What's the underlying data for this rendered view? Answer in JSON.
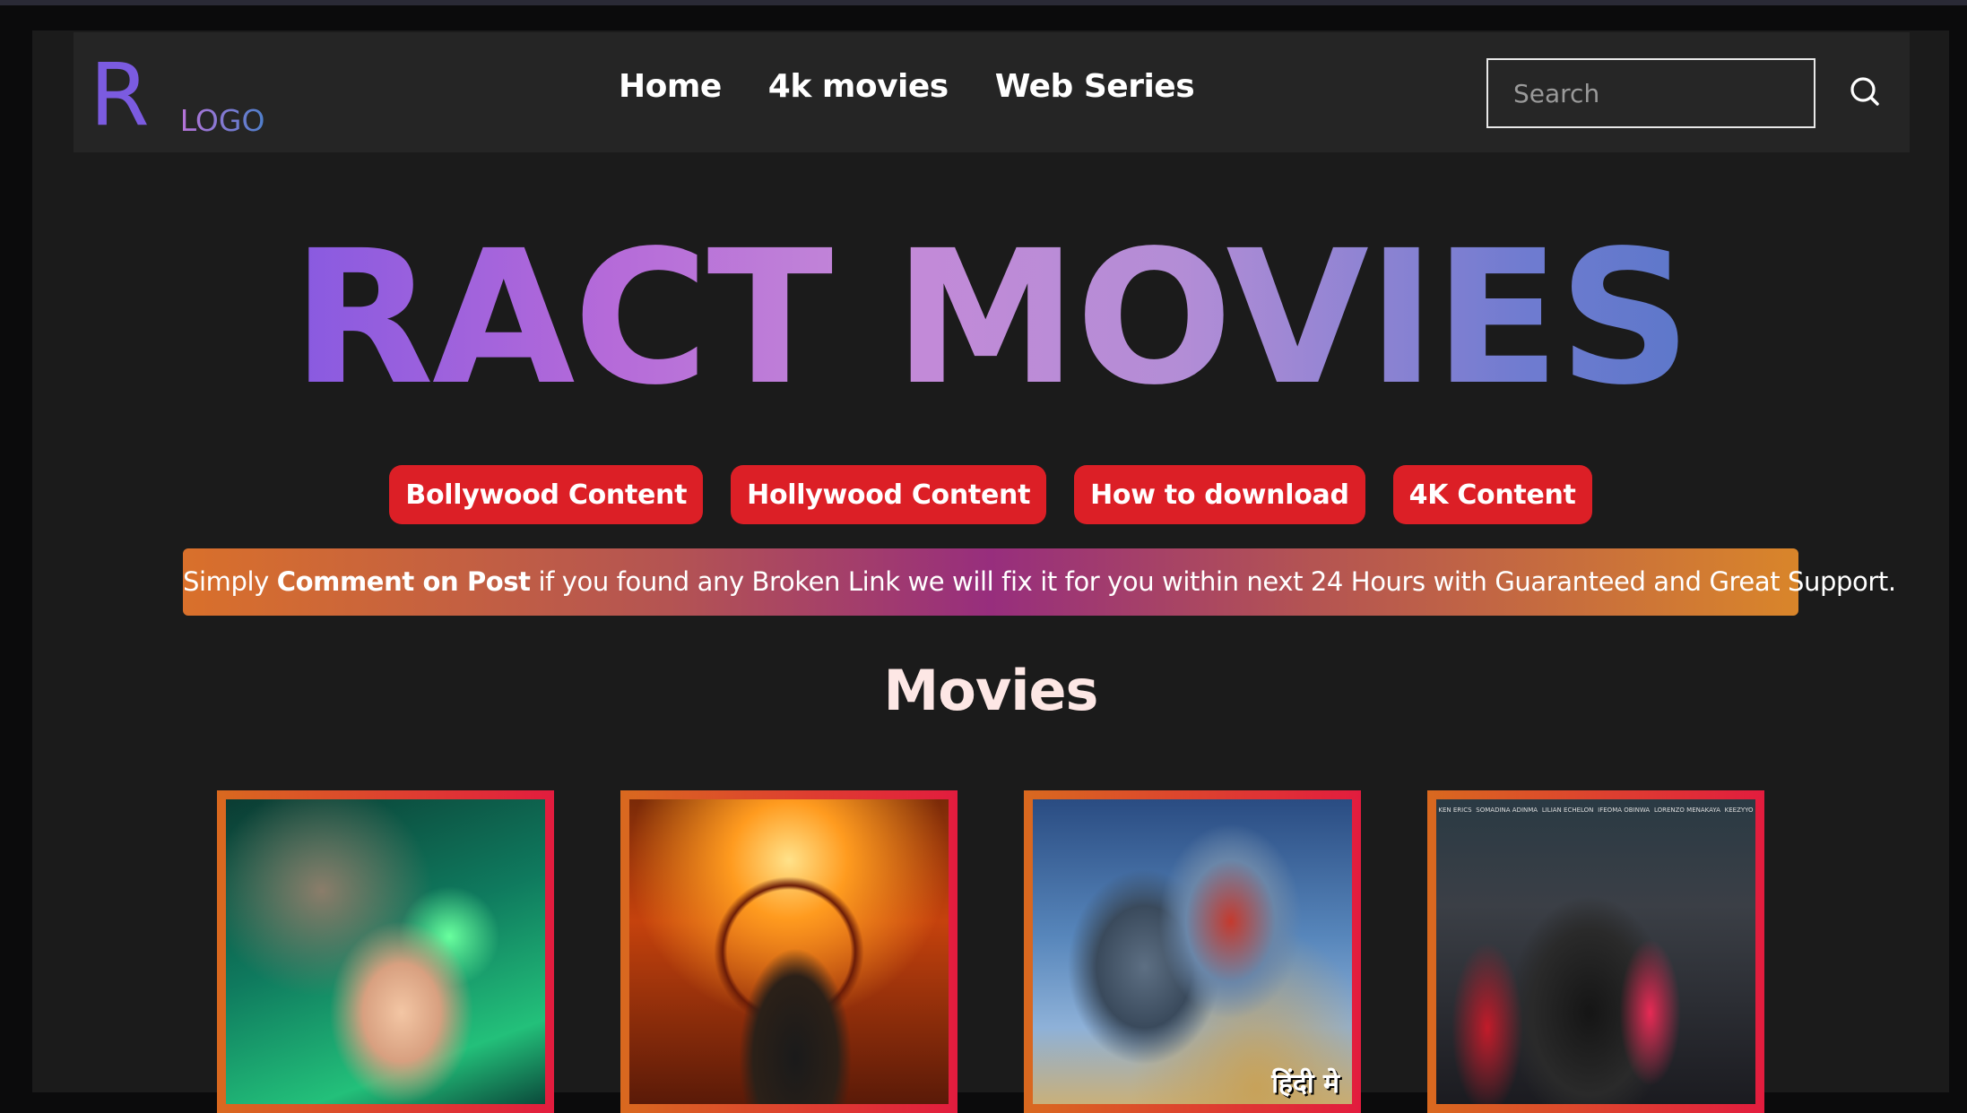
{
  "header": {
    "logo_letter": "R",
    "logo_text": "LOGO",
    "nav": [
      "Home",
      "4k movies",
      "Web Series"
    ],
    "search_placeholder": "Search"
  },
  "hero": {
    "title": "RACT MOVIES"
  },
  "categories": [
    "Bollywood Content",
    "Hollywood Content",
    "How to download",
    "4K Content"
  ],
  "notice": {
    "prefix": "Simply ",
    "bold": "Comment on Post",
    "suffix": " if you found any Broken Link we will fix it for you within next 24 Hours with Guaranteed and Great Support."
  },
  "section": {
    "title": "Movies"
  },
  "movies": [
    {
      "poster_icon": "poster-scientist"
    },
    {
      "poster_icon": "poster-oppenheimer"
    },
    {
      "poster_icon": "poster-transformers",
      "tag": "हिंदी मे"
    },
    {
      "poster_icon": "poster-group-cast",
      "cast": [
        "KEN ERICS",
        "SOMADINA ADINMA",
        "LILIAN ECHELON",
        "IFEOMA OBINWA",
        "LORENZO MENAKAYA",
        "KEEZYYO"
      ]
    }
  ],
  "colors": {
    "accent_red": "#dc1f26",
    "logo_purple": "#7b5be0",
    "page_bg": "#1b1b1b",
    "header_bg": "#252525"
  }
}
